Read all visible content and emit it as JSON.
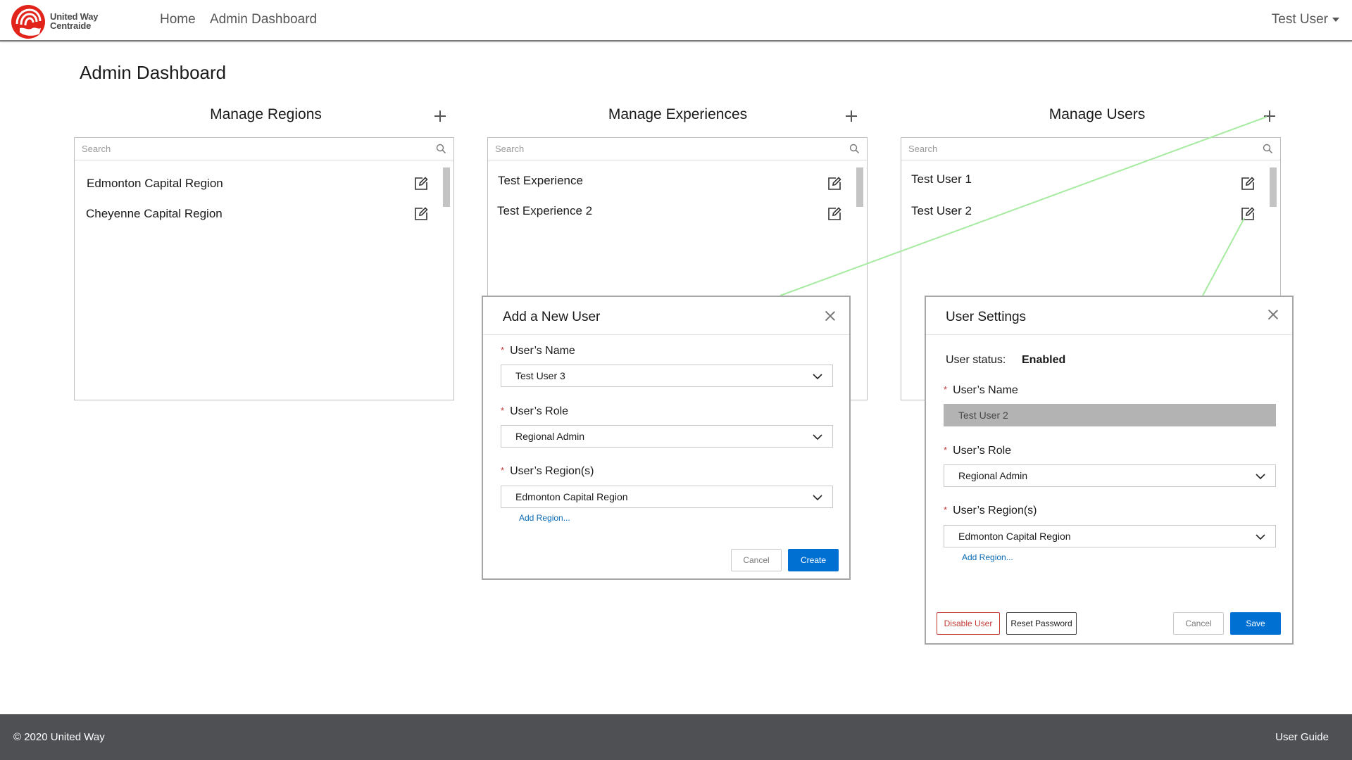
{
  "header": {
    "logo_text_line1": "United Way",
    "logo_text_line2": "Centraide",
    "nav": [
      "Home",
      "Admin Dashboard"
    ],
    "user_menu_label": "Test User"
  },
  "page": {
    "title": "Admin Dashboard"
  },
  "regions": {
    "title": "Manage Regions",
    "search_placeholder": "Search",
    "items": [
      "Edmonton Capital Region",
      "Cheyenne Capital Region"
    ]
  },
  "experiences": {
    "title": "Manage Experiences",
    "search_placeholder": "Search",
    "items": [
      "Test Experience",
      "Test Experience 2"
    ]
  },
  "users": {
    "title": "Manage Users",
    "search_placeholder": "Search",
    "items": [
      "Test User 1",
      "Test User 2"
    ]
  },
  "add_user_modal": {
    "title": "Add a New User",
    "name_label": "User’s Name",
    "name_value": "Test User 3",
    "role_label": "User’s Role",
    "role_value": "Regional Admin",
    "regions_label": "User’s Region(s)",
    "regions_value": "Edmonton Capital Region",
    "add_region_link": "Add Region...",
    "cancel_label": "Cancel",
    "create_label": "Create"
  },
  "user_settings_modal": {
    "title": "User Settings",
    "status_label": "User status:",
    "status_value": "Enabled",
    "name_label": "User’s Name",
    "name_value": "Test User 2",
    "role_label": "User’s Role",
    "role_value": "Regional Admin",
    "regions_label": "User’s Region(s)",
    "regions_value": "Edmonton Capital Region",
    "add_region_link": "Add Region...",
    "disable_label": "Disable User",
    "reset_label": "Reset Password",
    "cancel_label": "Cancel",
    "save_label": "Save"
  },
  "footer": {
    "copyright": "© 2020 United Way",
    "guide_link": "User Guide"
  },
  "colors": {
    "brand_red": "#e2231a",
    "primary_blue": "#0070d2",
    "danger_red": "#c23934",
    "footer_bg": "#4e5053",
    "connector_green": "#a6eba0"
  }
}
